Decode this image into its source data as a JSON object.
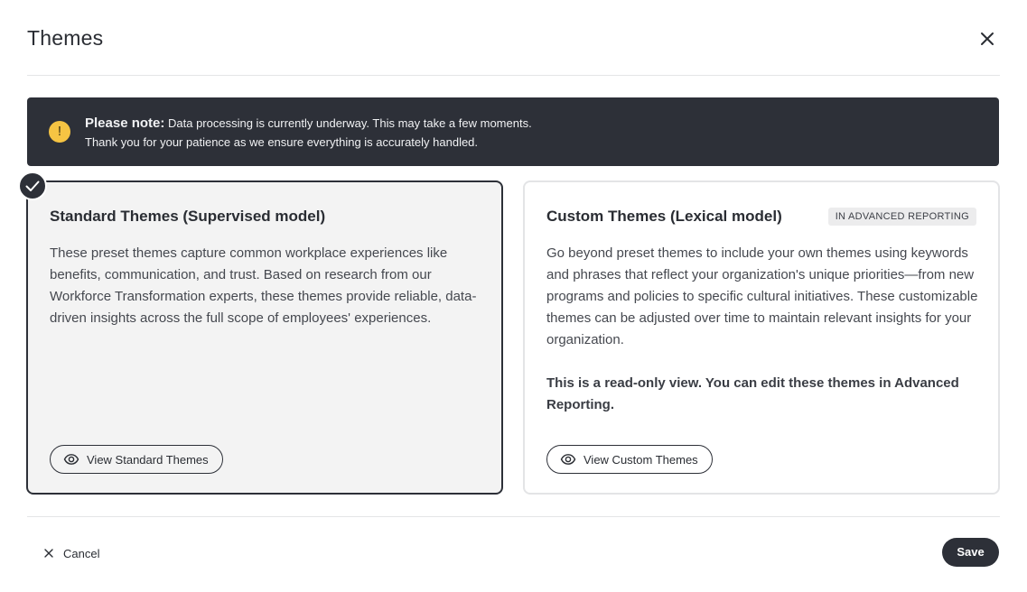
{
  "dialog": {
    "title": "Themes"
  },
  "banner": {
    "icon": "warning-icon",
    "icon_glyph": "!",
    "bold_label": "Please note:",
    "line1": "Data processing is currently underway. This may take a few moments.",
    "line2": "Thank you for your patience as we ensure everything is accurately handled.",
    "colors": {
      "background": "#2d3038",
      "icon": "#f6c443"
    }
  },
  "cards": {
    "standard": {
      "selected": true,
      "title": "Standard Themes (Supervised model)",
      "description": "These preset themes capture common workplace experiences like benefits, communication, and trust. Based on research from our Workforce Transformation experts, these themes provide reliable, data-driven insights across the full scope of employees' experiences.",
      "button_label": "View Standard Themes",
      "button_icon": "eye-icon"
    },
    "custom": {
      "selected": false,
      "title": "Custom Themes (Lexical model)",
      "badge": "IN ADVANCED REPORTING",
      "description": "Go beyond preset themes to include your own themes using keywords and phrases that reflect your organization's unique priorities—from new programs and policies to specific cultural initiatives. These customizable themes can be adjusted over time to maintain relevant insights for your organization.",
      "note": "This is a read-only view. You can edit these themes in Advanced Reporting.",
      "button_label": "View Custom Themes",
      "button_icon": "eye-icon"
    }
  },
  "footer": {
    "cancel_label": "Cancel",
    "save_label": "Save"
  }
}
